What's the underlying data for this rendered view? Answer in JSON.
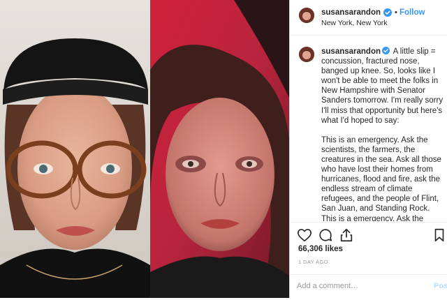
{
  "post": {
    "username": "susansarandon",
    "follow_label": "Follow",
    "separator": "•",
    "location": "New York, New York",
    "caption_paragraphs": [
      "A little slip = concussion, fractured nose, banged up knee. So, looks like I won't be able to meet the folks in New Hampshire with Senator Sanders tomorrow. I'm really sorry I'll miss that opportunity but here's what I'd hoped to say:",
      "This is an emergency. Ask the scientists, the farmers, the creatures in the sea. Ask all those who have lost their homes from hurricanes, flood and fire, ask the endless stream of climate refugees, and the people of Flint, San Juan, and Standing Rock. This is a emergency. Ask the mothers who have lost their children to the opioid epidemic or because of the price of insulin. Ask the mothers who have lost their kids to gun violence in schools, in"
    ],
    "likes": "66,306 likes",
    "date": "1 DAY AGO",
    "comment_placeholder": "Add a comment…",
    "post_label": "Post"
  },
  "icons": {
    "verified": "verified-badge-icon",
    "like": "heart-icon",
    "comment": "comment-icon",
    "share": "share-icon",
    "save": "bookmark-icon"
  },
  "colors": {
    "link_blue": "#3897f0",
    "text": "#262626",
    "muted": "#999999",
    "border": "#efefef",
    "post_disabled": "#b2dffc"
  }
}
